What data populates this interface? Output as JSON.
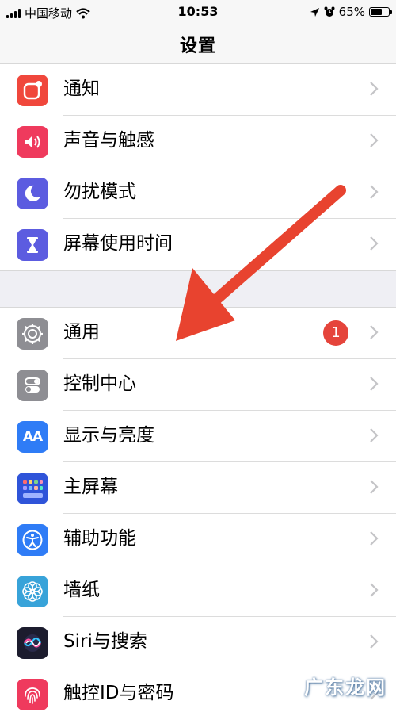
{
  "status_bar": {
    "carrier": "中国移动",
    "time": "10:53",
    "battery": "65%"
  },
  "nav": {
    "title": "设置"
  },
  "group1": [
    {
      "label": "通知",
      "icon": "notifications-icon",
      "color": "#f0473c"
    },
    {
      "label": "声音与触感",
      "icon": "sound-icon",
      "color": "#ef3a5d"
    },
    {
      "label": "勿扰模式",
      "icon": "moon-icon",
      "color": "#5c5ce0"
    },
    {
      "label": "屏幕使用时间",
      "icon": "hourglass-icon",
      "color": "#5c5ce0"
    }
  ],
  "group2": [
    {
      "label": "通用",
      "icon": "gear-icon",
      "color": "#8e8e93",
      "badge": "1"
    },
    {
      "label": "控制中心",
      "icon": "toggles-icon",
      "color": "#8e8e93"
    },
    {
      "label": "显示与亮度",
      "icon": "text-size-icon",
      "color": "#2f7cf6",
      "glyph": "AA"
    },
    {
      "label": "主屏幕",
      "icon": "home-screen-icon",
      "color": "#2f54d9"
    },
    {
      "label": "辅助功能",
      "icon": "accessibility-icon",
      "color": "#2f7cf6"
    },
    {
      "label": "墙纸",
      "icon": "wallpaper-flower-icon",
      "color": "#38a3d9"
    },
    {
      "label": "Siri与搜索",
      "icon": "siri-icon",
      "color": "#1c1c2e"
    },
    {
      "label": "触控ID与密码",
      "icon": "fingerprint-icon",
      "color": "#ef3a5d"
    }
  ],
  "watermark": "广东龙网",
  "annotation": {
    "arrow_color": "#e8432f"
  }
}
